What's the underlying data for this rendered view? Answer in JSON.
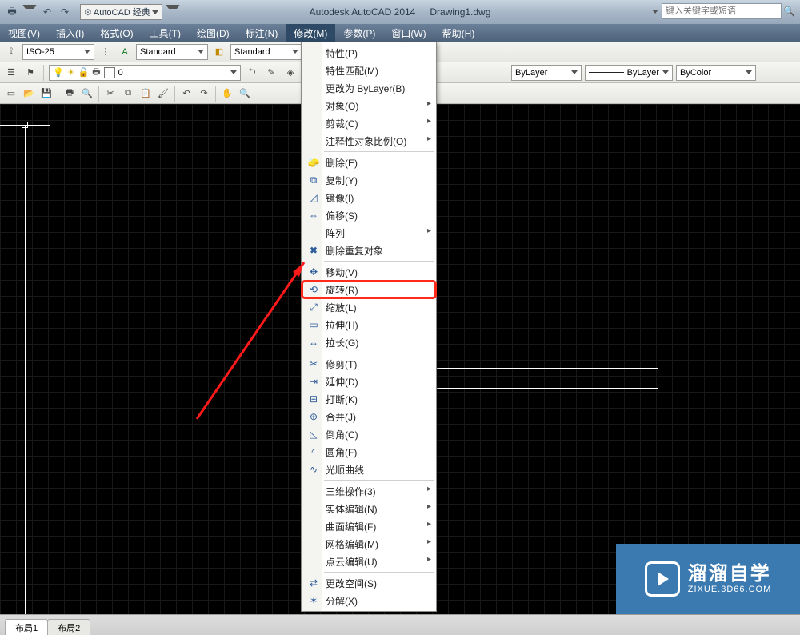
{
  "title": {
    "app": "Autodesk AutoCAD 2014",
    "file": "Drawing1.dwg"
  },
  "workspace": {
    "label": "AutoCAD 经典"
  },
  "search": {
    "placeholder": "键入关键字或短语"
  },
  "menubar": [
    {
      "id": "view",
      "label": "视图(V)"
    },
    {
      "id": "insert",
      "label": "插入(I)"
    },
    {
      "id": "format",
      "label": "格式(O)"
    },
    {
      "id": "tools",
      "label": "工具(T)"
    },
    {
      "id": "draw",
      "label": "绘图(D)"
    },
    {
      "id": "dim",
      "label": "标注(N)"
    },
    {
      "id": "modify",
      "label": "修改(M)"
    },
    {
      "id": "param",
      "label": "参数(P)"
    },
    {
      "id": "window",
      "label": "窗口(W)"
    },
    {
      "id": "help",
      "label": "帮助(H)"
    }
  ],
  "toolbar1": {
    "dimstyle": "ISO-25",
    "textstyle1": "Standard",
    "textstyle2": "Standard"
  },
  "toolbar2": {
    "layer": "0",
    "linetype": "ByLayer",
    "lineweight": "ByLayer",
    "plotstyle": "ByColor"
  },
  "dropdown": {
    "groups": [
      [
        {
          "icon": "",
          "label": "特性(P)",
          "id": "properties"
        },
        {
          "icon": "",
          "label": "特性匹配(M)",
          "id": "matchprop"
        },
        {
          "icon": "",
          "label": "更改为 ByLayer(B)",
          "id": "bylayer"
        },
        {
          "icon": "",
          "label": "对象(O)",
          "id": "object",
          "submenu": true
        },
        {
          "icon": "",
          "label": "剪裁(C)",
          "id": "clip",
          "submenu": true
        },
        {
          "icon": "",
          "label": "注释性对象比例(O)",
          "id": "annoscale",
          "submenu": true
        }
      ],
      [
        {
          "icon": "🧽",
          "label": "删除(E)",
          "id": "erase"
        },
        {
          "icon": "⧉",
          "label": "复制(Y)",
          "id": "copy"
        },
        {
          "icon": "◿",
          "label": "镜像(I)",
          "id": "mirror"
        },
        {
          "icon": "⇔",
          "label": "偏移(S)",
          "id": "offset"
        },
        {
          "icon": "",
          "label": "阵列",
          "id": "array",
          "submenu": true
        },
        {
          "icon": "✖",
          "label": "删除重复对象",
          "id": "overkill"
        }
      ],
      [
        {
          "icon": "✥",
          "label": "移动(V)",
          "id": "move"
        },
        {
          "icon": "⟲",
          "label": "旋转(R)",
          "id": "rotate",
          "hl": true
        },
        {
          "icon": "⤢",
          "label": "缩放(L)",
          "id": "scale"
        },
        {
          "icon": "▭",
          "label": "拉伸(H)",
          "id": "stretch"
        },
        {
          "icon": "↔",
          "label": "拉长(G)",
          "id": "lengthen"
        }
      ],
      [
        {
          "icon": "✂",
          "label": "修剪(T)",
          "id": "trim"
        },
        {
          "icon": "⇥",
          "label": "延伸(D)",
          "id": "extend"
        },
        {
          "icon": "⊟",
          "label": "打断(K)",
          "id": "break"
        },
        {
          "icon": "⊕",
          "label": "合并(J)",
          "id": "join"
        },
        {
          "icon": "◺",
          "label": "倒角(C)",
          "id": "chamfer"
        },
        {
          "icon": "◜",
          "label": "圆角(F)",
          "id": "fillet"
        },
        {
          "icon": "∿",
          "label": "光顺曲线",
          "id": "blend"
        }
      ],
      [
        {
          "icon": "",
          "label": "三维操作(3)",
          "id": "3dops",
          "submenu": true
        },
        {
          "icon": "",
          "label": "实体编辑(N)",
          "id": "solidedit",
          "submenu": true
        },
        {
          "icon": "",
          "label": "曲面编辑(F)",
          "id": "surfedit",
          "submenu": true
        },
        {
          "icon": "",
          "label": "网格编辑(M)",
          "id": "meshedit",
          "submenu": true
        },
        {
          "icon": "",
          "label": "点云编辑(U)",
          "id": "pcedit",
          "submenu": true
        }
      ],
      [
        {
          "icon": "⇄",
          "label": "更改空间(S)",
          "id": "chspace"
        },
        {
          "icon": "✶",
          "label": "分解(X)",
          "id": "explode"
        }
      ]
    ]
  },
  "tabs": {
    "items": [
      "布局1",
      "布局2"
    ]
  },
  "watermark": {
    "title": "溜溜自学",
    "sub": "ZIXUE.3D66.COM"
  }
}
